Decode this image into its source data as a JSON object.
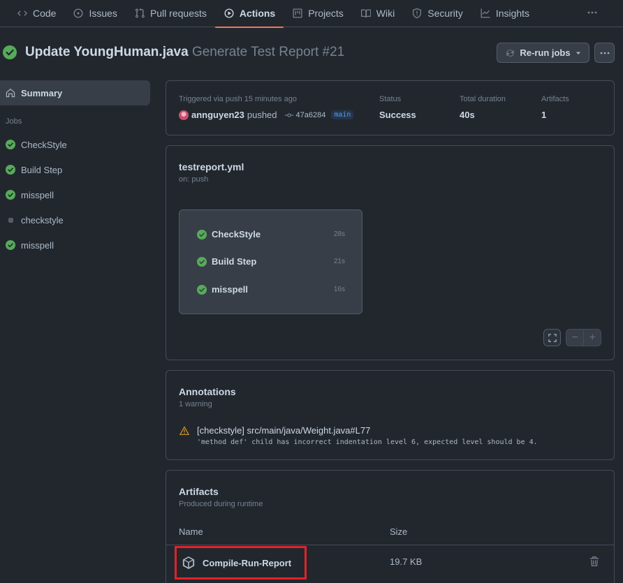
{
  "nav": {
    "items": [
      {
        "label": "Code"
      },
      {
        "label": "Issues"
      },
      {
        "label": "Pull requests"
      },
      {
        "label": "Actions"
      },
      {
        "label": "Projects"
      },
      {
        "label": "Wiki"
      },
      {
        "label": "Security"
      },
      {
        "label": "Insights"
      }
    ],
    "active": "Actions",
    "more": "···"
  },
  "run": {
    "commit_title": "Update YoungHuman.java",
    "workflow_label": "Generate Test Report #21",
    "rerun_label": "Re-run jobs"
  },
  "sidebar": {
    "summary_label": "Summary",
    "jobs_label": "Jobs",
    "jobs": [
      {
        "name": "CheckStyle",
        "state": "success"
      },
      {
        "name": "Build Step",
        "state": "success"
      },
      {
        "name": "misspell",
        "state": "success"
      },
      {
        "name": "checkstyle",
        "state": "pending"
      },
      {
        "name": "misspell",
        "state": "success"
      }
    ]
  },
  "summary": {
    "trigger_text": "Triggered via push 15 minutes ago",
    "actor": "annguyen23",
    "action": "pushed",
    "sha": "47a6284",
    "branch": "main",
    "status_label": "Status",
    "status_value": "Success",
    "duration_label": "Total duration",
    "duration_value": "40s",
    "artifacts_label": "Artifacts",
    "artifacts_value": "1"
  },
  "workflow": {
    "file": "testreport.yml",
    "trigger": "on: push",
    "jobs": [
      {
        "name": "CheckStyle",
        "duration": "28s"
      },
      {
        "name": "Build Step",
        "duration": "21s"
      },
      {
        "name": "misspell",
        "duration": "16s"
      }
    ],
    "zoom_out": "−",
    "zoom_in": "+"
  },
  "annotations": {
    "title": "Annotations",
    "count": "1 warning",
    "items": [
      {
        "title": "[checkstyle] src/main/java/Weight.java#L77",
        "message": "'method def' child has incorrect indentation level 6, expected level should be 4."
      }
    ]
  },
  "artifacts": {
    "title": "Artifacts",
    "subtitle": "Produced during runtime",
    "col_name": "Name",
    "col_size": "Size",
    "rows": [
      {
        "name": "Compile-Run-Report",
        "size": "19.7 KB"
      }
    ]
  },
  "colors": {
    "success": "#57ab5a",
    "warning": "#c69026",
    "active_underline": "#ec775c",
    "highlight_box": "#e0232a"
  }
}
